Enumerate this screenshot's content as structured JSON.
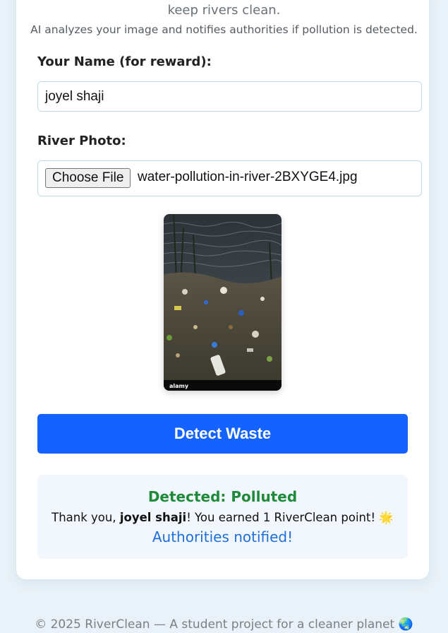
{
  "header": {
    "tagline_end": "keep rivers clean.",
    "subtitle": "AI analyzes your image and notifies authorities if pollution is detected."
  },
  "form": {
    "name_label": "Your Name (for reward):",
    "name_value": "joyel shaji",
    "photo_label": "River Photo:",
    "choose_file_label": "Choose File",
    "file_name": "water-pollution-in-river-2BXYGE4.jpg",
    "preview_watermark": "alamy",
    "detect_button_label": "Detect Waste"
  },
  "result": {
    "status": "Detected: Polluted",
    "thanks_prefix": "Thank you, ",
    "user_name": "joyel shaji",
    "thanks_suffix": "! You earned 1 RiverClean point! 🌟",
    "notified": "Authorities notified!"
  },
  "footer": {
    "text": "© 2025 RiverClean — A student project for a cleaner planet 🌏"
  }
}
